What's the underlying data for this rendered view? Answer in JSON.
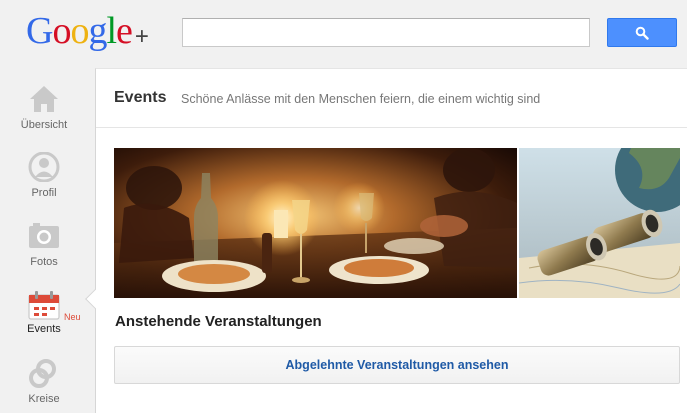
{
  "header": {
    "logo": {
      "letters": [
        "G",
        "o",
        "o",
        "g",
        "l",
        "e"
      ],
      "suffix": "+"
    },
    "search": {
      "value": "",
      "placeholder": ""
    }
  },
  "leftnav": {
    "items": [
      {
        "label": "Übersicht",
        "icon": "home-icon"
      },
      {
        "label": "Profil",
        "icon": "profile-icon"
      },
      {
        "label": "Fotos",
        "icon": "camera-icon"
      },
      {
        "label": "Events",
        "icon": "calendar-icon",
        "badge": "Neu",
        "active": true
      },
      {
        "label": "Kreise",
        "icon": "circles-icon"
      }
    ]
  },
  "main": {
    "title": "Events",
    "subtitle": "Schöne Anlässe mit den Menschen feiern, die einem wichtig sind",
    "section_heading": "Anstehende Veranstaltungen",
    "declined_button_label": "Abgelehnte Veranstaltungen ansehen"
  },
  "colors": {
    "google_blue": "#3369e8",
    "google_red": "#d50f25",
    "google_yellow": "#eeb211",
    "google_green": "#009925",
    "search_button": "#4d90fe",
    "link_blue": "#1f5aa6",
    "badge_red": "#dd4b39"
  }
}
